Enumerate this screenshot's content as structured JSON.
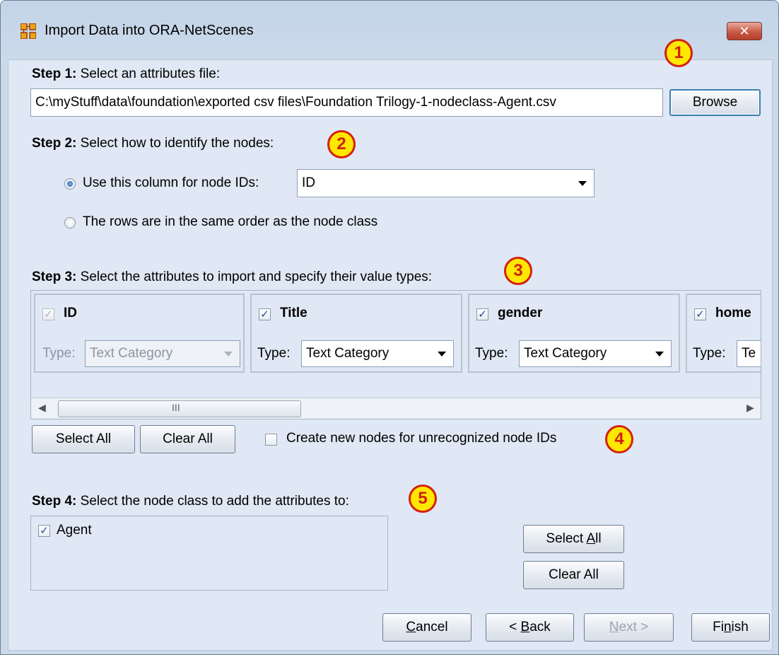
{
  "window": {
    "title": "Import Data into ORA-NetScenes",
    "close_label": "✕"
  },
  "callouts": [
    "1",
    "2",
    "3",
    "4",
    "5"
  ],
  "step1": {
    "bold": "Step 1:",
    "text": "Select an attributes file:",
    "file_path": "C:\\myStuff\\data\\foundation\\exported csv files\\Foundation Trilogy-1-nodeclass-Agent.csv",
    "browse_label": "Browse"
  },
  "step2": {
    "bold": "Step 2:",
    "text": "Select how to identify the nodes:",
    "option_column": "Use this column for node IDs:",
    "column_value": "ID",
    "option_rows": "The rows are in the same order as the node class"
  },
  "step3": {
    "bold": "Step 3:",
    "text": "Select the attributes to import and specify their value types:",
    "type_label": "Type:",
    "attributes": [
      {
        "name": "ID",
        "checked": true,
        "enabled": false,
        "type": "Text Category"
      },
      {
        "name": "Title",
        "checked": true,
        "enabled": true,
        "type": "Text Category"
      },
      {
        "name": "gender",
        "checked": true,
        "enabled": true,
        "type": "Text Category"
      },
      {
        "name": "home",
        "checked": true,
        "enabled": true,
        "type": "Te"
      }
    ],
    "scroll_grip": "III",
    "select_all_label": "Select All",
    "clear_all_label": "Clear All",
    "create_nodes_label": "Create new nodes for unrecognized node IDs"
  },
  "step4": {
    "bold": "Step 4:",
    "text": "Select the node class to add the attributes to:",
    "node_classes": [
      {
        "name": "Agent",
        "checked": true
      }
    ],
    "select_all_pre": "Select ",
    "select_all_key": "A",
    "select_all_post": "ll",
    "clear_all_label": "Clear All"
  },
  "footer": {
    "cancel_key": "C",
    "cancel_rest": "ancel",
    "back_pre": "< ",
    "back_key": "B",
    "back_rest": "ack",
    "next_key": "N",
    "next_rest": "ext >",
    "finish_pre": "Fi",
    "finish_key": "n",
    "finish_rest": "ish"
  },
  "colors": {
    "callout_fill": "#ffe800",
    "callout_border": "#d42010",
    "client_bg": "#dfe8f4"
  }
}
